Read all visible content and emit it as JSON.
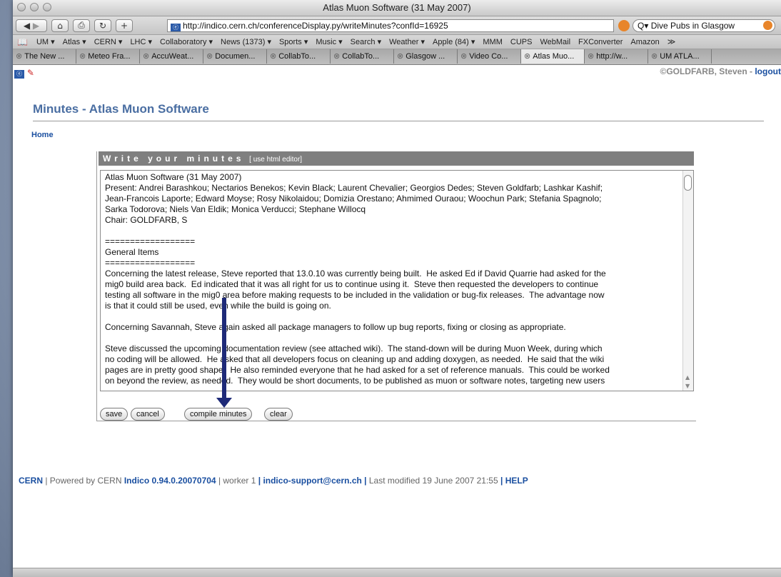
{
  "window": {
    "title": "Atlas Muon Software (31 May 2007)"
  },
  "nav": {
    "url": "http://indico.cern.ch/conferenceDisplay.py/writeMinutes?confId=16925",
    "search": "Q▾ Dive Pubs in Glasgow"
  },
  "bookmarks": [
    "UM ▾",
    "Atlas ▾",
    "CERN ▾",
    "LHC ▾",
    "Collaboratory ▾",
    "News (1373) ▾",
    "Sports ▾",
    "Music ▾",
    "Search ▾",
    "Weather ▾",
    "Apple (84) ▾",
    "MMM",
    "CUPS",
    "WebMail",
    "FXConverter",
    "Amazon",
    "≫"
  ],
  "tabs": [
    "The New ...",
    "Meteo Fra...",
    "AccuWeat...",
    "Documen...",
    "CollabTo...",
    "CollabTo...",
    "Glasgow ...",
    "Video Co...",
    "Atlas Muo...",
    "http://w...",
    "UM ATLA..."
  ],
  "active_tab": 8,
  "user": {
    "name": "GOLDFARB, Steven",
    "separator": " - ",
    "logout": "logout"
  },
  "page": {
    "title": "Minutes - Atlas Muon Software",
    "home": "Home"
  },
  "editor": {
    "heading": "Write your minutes",
    "html_editor": "[ use html editor]",
    "text": [
      "Atlas Muon Software (31 May 2007)\nPresent: Andrei Barashkou; Nectarios Benekos; Kevin Black; Laurent Chevalier; Georgios Dedes; Steven Goldfarb; Lashkar Kashif;\nJean-Francois Laporte; Edward Moyse; Rosy Nikolaidou; Domizia Orestano; Ahmimed Ouraou; Woochun Park; Stefania Spagnolo;\nSarka Todorova; Niels Van Eldik; Monica Verducci; Stephane Willocq\nChair: GOLDFARB, S",
      "==================\nGeneral Items\n==================\nConcerning the latest release, Steve reported that 13.0.10 was currently being built.  He asked Ed if David Quarrie had asked for the\nmig0 build area back.  Ed indicated that it was all right for us to continue using it.  Steve then requested the developers to continue\ntesting all software in the mig0 area before making requests to be included in the validation or bug-fix releases.  The advantage now\nis that it could still be used, even while the build is going on.",
      "Concerning Savannah, Steve again asked all package managers to follow up bug reports, fixing or closing as appropriate.",
      "Steve discussed the upcoming documentation review (see attached wiki).  The stand-down will be during Muon Week, during which\nno coding will be allowed.  He asked that all developers focus on cleaning up and adding doxygen, as needed.  He said that the wiki\npages are in pretty good shape.  He also reminded everyone that he had asked for a set of reference manuals.  This could be worked\non beyond the review, as needed.  They would be short documents, to be published as muon or software notes, targeting new users"
    ]
  },
  "buttons": {
    "save": "save",
    "cancel": "cancel",
    "compile": "compile minutes",
    "clear": "clear"
  },
  "footer": {
    "cern": "CERN",
    "sep1": " | Powered by CERN ",
    "indico": "Indico 0.94.0.20070704",
    "sep2": " | worker 1 ",
    "support": "| indico-support@cern.ch |",
    "modified": " Last modified 19 June 2007 21:55 ",
    "help": "| HELP"
  },
  "colors": {
    "accent": "#1a4fa0",
    "title": "#4a6ea2",
    "arrow": "#1e2a78",
    "editor_head": "#7f7f7f"
  },
  "icons": [
    "back-icon",
    "forward-icon",
    "home-icon",
    "print-icon",
    "reload-icon",
    "new-tab-icon",
    "favicon",
    "rss-icon",
    "search-icon",
    "bookmarks-book-icon",
    "tab-close-icon",
    "cern-logo-icon",
    "pencil-icon",
    "copyright-icon",
    "scroll-thumb",
    "down-arrow-annotation"
  ]
}
